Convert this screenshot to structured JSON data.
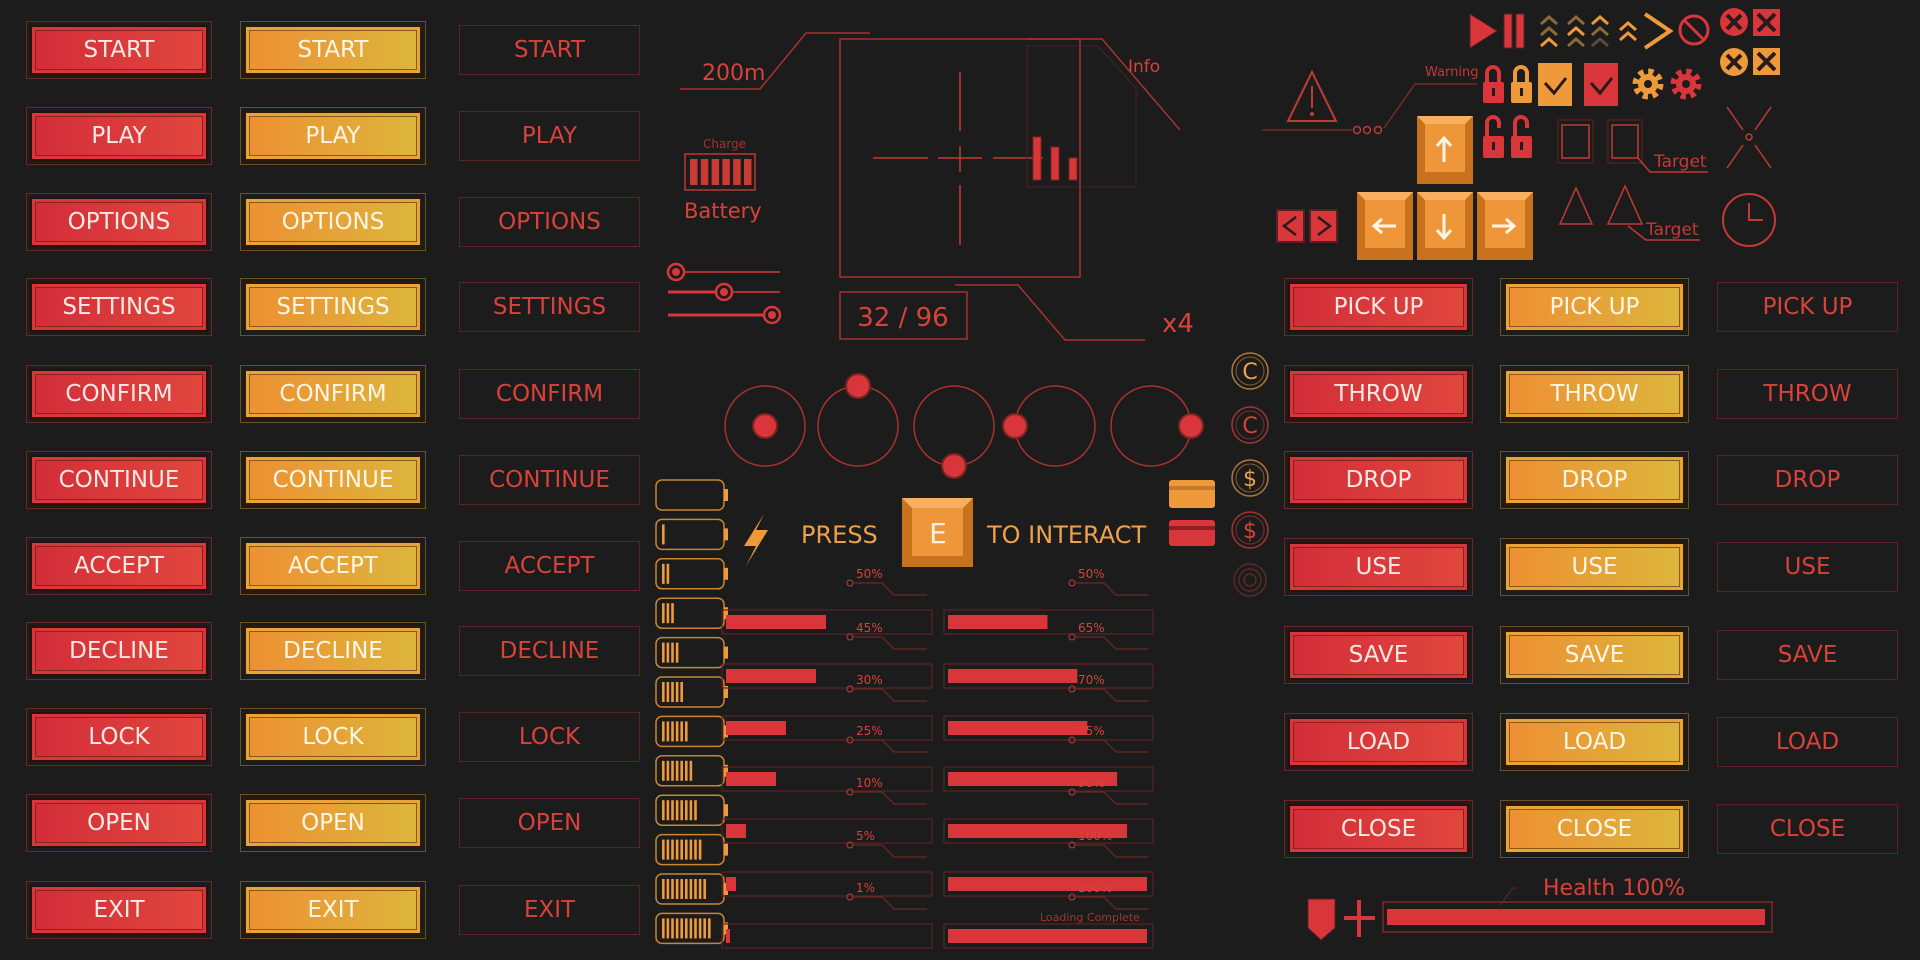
{
  "menu_buttons": [
    "START",
    "PLAY",
    "OPTIONS",
    "SETTINGS",
    "CONFIRM",
    "CONTINUE",
    "ACCEPT",
    "DECLINE",
    "LOCK",
    "OPEN",
    "EXIT"
  ],
  "action_buttons": [
    "PICK UP",
    "THROW",
    "DROP",
    "USE",
    "SAVE",
    "LOAD",
    "CLOSE"
  ],
  "button_styles": [
    "red",
    "orange",
    "outline"
  ],
  "hud": {
    "distance": "200m",
    "charge_label": "Charge",
    "battery_label": "Battery",
    "ammo": "32 / 96",
    "zoom": "x4",
    "info_label": "Info",
    "sliders": [
      0,
      0.5,
      1
    ]
  },
  "dials": [
    "center",
    "top",
    "bottom",
    "left",
    "right"
  ],
  "interact": {
    "press": "PRESS",
    "key": "E",
    "suffix": "TO INTERACT"
  },
  "coins": [
    {
      "symbol": "C",
      "color": "#eea04a"
    },
    {
      "symbol": "C",
      "color": "#d8423a"
    },
    {
      "symbol": "$",
      "color": "#eea04a"
    },
    {
      "symbol": "$",
      "color": "#d8423a"
    }
  ],
  "battery_levels": [
    0,
    1,
    2,
    3,
    4,
    5,
    6,
    7,
    8,
    9,
    10,
    11
  ],
  "battery_max": 11,
  "progress_left": [
    50,
    45,
    30,
    25,
    10,
    5,
    1
  ],
  "progress_right": [
    50,
    65,
    70,
    85,
    90,
    100,
    100
  ],
  "loading_label": "Loading Complete",
  "icons": {
    "warning_label": "Warning",
    "target_label": "Target"
  },
  "health": {
    "label": "Health 100%",
    "value": 100
  },
  "colors": {
    "red": "#d8363a",
    "orange": "#ee9a3a",
    "line": "#a8322e",
    "background": "#1c1c1c"
  }
}
